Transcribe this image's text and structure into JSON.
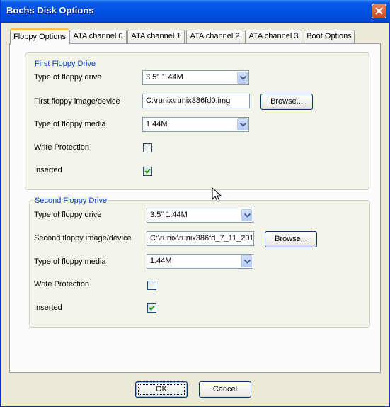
{
  "window": {
    "title": "Bochs Disk Options"
  },
  "tabs": [
    {
      "label": "Floppy Options",
      "active": true
    },
    {
      "label": "ATA channel 0",
      "active": false
    },
    {
      "label": "ATA channel 1",
      "active": false
    },
    {
      "label": "ATA channel 2",
      "active": false
    },
    {
      "label": "ATA channel 3",
      "active": false
    },
    {
      "label": "Boot Options",
      "active": false
    }
  ],
  "first": {
    "legend": "First Floppy Drive",
    "drive_type_label": "Type of floppy drive",
    "drive_type_value": "3.5\" 1.44M",
    "image_label": "First floppy image/device",
    "image_value": "C:\\runix\\runix386fd0.img",
    "browse_label": "Browse...",
    "media_label": "Type of floppy media",
    "media_value": "1.44M",
    "write_protection_label": "Write Protection",
    "write_protection_checked": false,
    "inserted_label": "Inserted",
    "inserted_checked": true
  },
  "second": {
    "legend": "Second Floppy Drive",
    "drive_type_label": "Type of floppy drive",
    "drive_type_value": "3.5\" 1.44M",
    "image_label": "Second floppy image/device",
    "image_value": "C:\\runix\\runix386fd_7_11_201",
    "browse_label": "Browse...",
    "media_label": "Type of floppy media",
    "media_value": "1.44M",
    "write_protection_label": "Write Protection",
    "write_protection_checked": false,
    "inserted_label": "Inserted",
    "inserted_checked": true
  },
  "footer": {
    "ok_label": "OK",
    "cancel_label": "Cancel"
  },
  "colors": {
    "title_bar": "#0050E0",
    "legend": "#0046D5",
    "active_tab_accent": "#FFC83C",
    "checkmark": "#21A121"
  }
}
